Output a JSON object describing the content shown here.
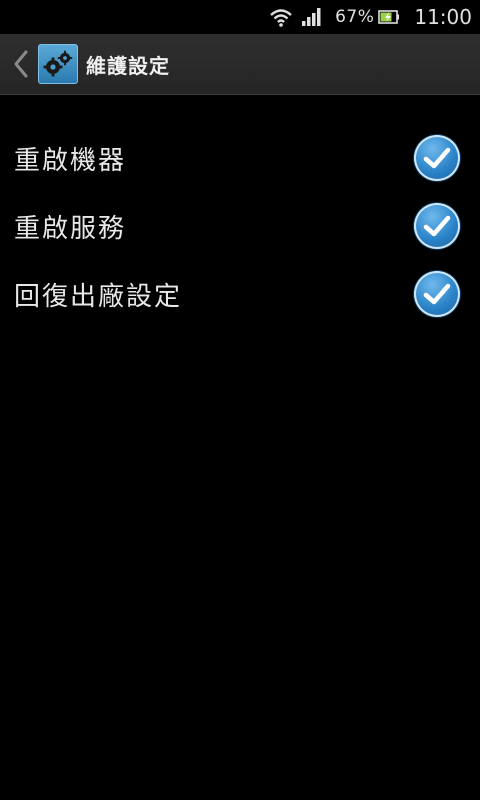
{
  "status_bar": {
    "battery_percent": "67%",
    "time": "11:00",
    "icons": [
      "wifi-icon",
      "signal-icon",
      "battery-charging-icon"
    ]
  },
  "action_bar": {
    "title": "維護設定",
    "back_icon": "chevron-left-icon",
    "app_icon": "gears-icon"
  },
  "settings": {
    "items": [
      {
        "label": "重啟機器",
        "checked": true
      },
      {
        "label": "重啟服務",
        "checked": true
      },
      {
        "label": "回復出廠設定",
        "checked": true
      }
    ]
  },
  "colors": {
    "background": "#000000",
    "action_bar": "#2b2b2b",
    "checkbox": "#2a82c8"
  }
}
